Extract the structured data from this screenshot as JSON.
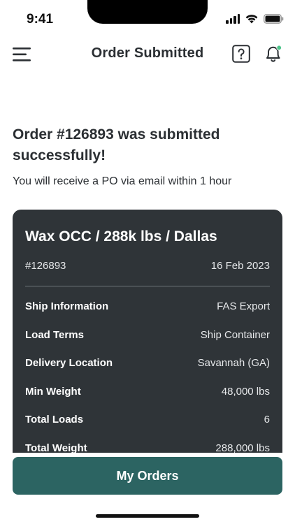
{
  "status_bar": {
    "time": "9:41"
  },
  "header": {
    "title": "Order Submitted",
    "icons": [
      "menu-icon",
      "help-icon",
      "bell-icon"
    ],
    "notification_dot_color": "#4cc38a"
  },
  "message": {
    "title": "Order #126893 was submitted successfully!",
    "subtitle": "You will receive a PO via email within 1 hour"
  },
  "card": {
    "title": "Wax OCC / 288k lbs / Dallas",
    "order_id": "#126893",
    "date": "16 Feb 2023",
    "rows": [
      {
        "label": "Ship Information",
        "value": "FAS Export"
      },
      {
        "label": "Load Terms",
        "value": "Ship Container"
      },
      {
        "label": "Delivery Location",
        "value": "Savannah (GA)"
      },
      {
        "label": "Min Weight",
        "value": "48,000 lbs"
      },
      {
        "label": "Total Loads",
        "value": "6"
      },
      {
        "label": "Total Weight",
        "value": "288,000 lbs"
      }
    ]
  },
  "cta": {
    "label": "My Orders"
  },
  "colors": {
    "card_bg": "#2f3438",
    "primary": "#2c6462",
    "text": "#2b2f33"
  }
}
